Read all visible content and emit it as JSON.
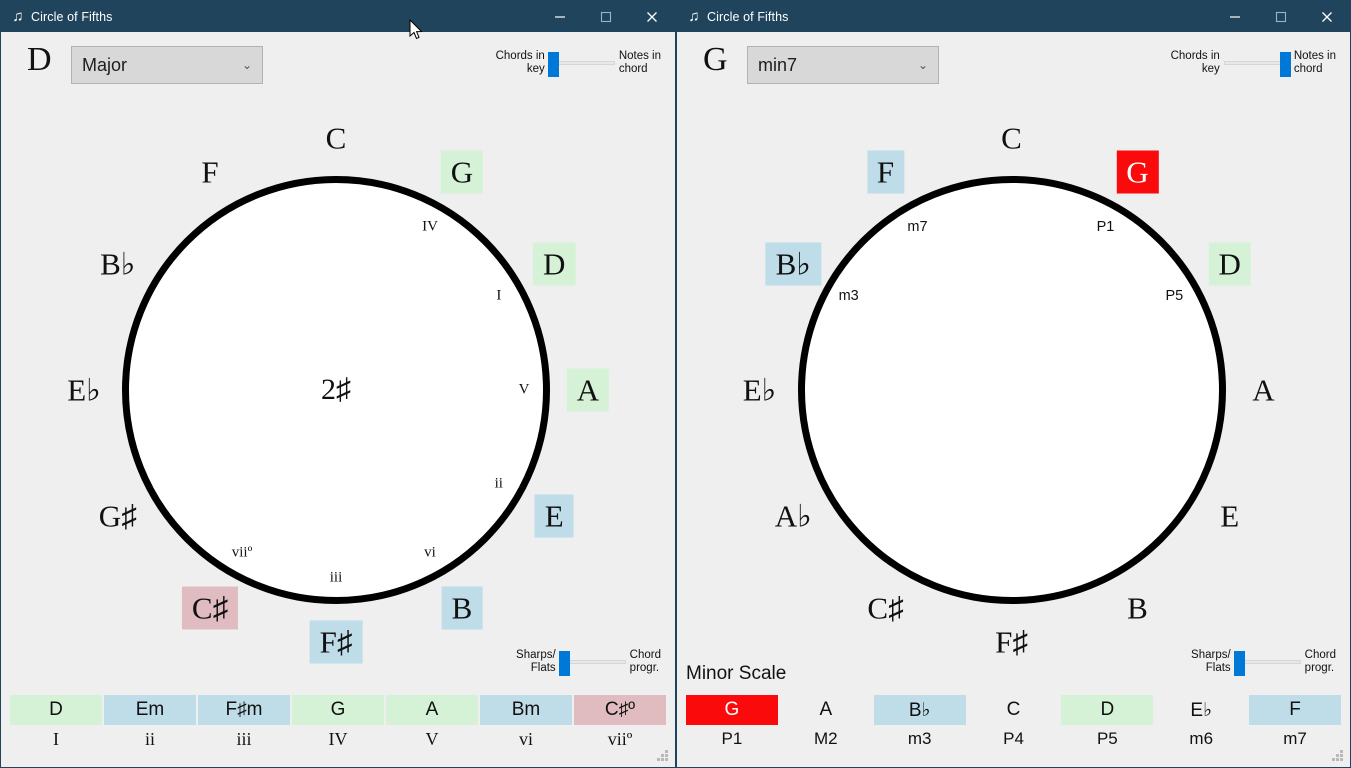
{
  "windows": [
    {
      "id": "left",
      "title": "Circle of Fifths",
      "icon": "music-note-icon",
      "controls": {
        "minimize": "minimize-icon",
        "maximize": "maximize-icon",
        "close": "close-icon"
      },
      "toolbar": {
        "key_letter": "D",
        "mode": "Major",
        "chevron": "⌄"
      },
      "top_slider": {
        "left_label": "Chords in\nkey",
        "right_label": "Notes in\nchord",
        "position": "left"
      },
      "circle": {
        "center_label": "2♯",
        "notes": [
          {
            "label": "C",
            "angle": 0,
            "highlight": "none"
          },
          {
            "label": "G",
            "angle": 30,
            "highlight": "green"
          },
          {
            "label": "D",
            "angle": 60,
            "highlight": "green"
          },
          {
            "label": "A",
            "angle": 90,
            "highlight": "green"
          },
          {
            "label": "E",
            "angle": 120,
            "highlight": "blue"
          },
          {
            "label": "B",
            "angle": 150,
            "highlight": "blue"
          },
          {
            "label": "F♯",
            "angle": 180,
            "highlight": "blue"
          },
          {
            "label": "C♯",
            "angle": 210,
            "highlight": "pink"
          },
          {
            "label": "G♯",
            "angle": 240,
            "highlight": "none"
          },
          {
            "label": "E♭",
            "angle": 270,
            "highlight": "none"
          },
          {
            "label": "B♭",
            "angle": 300,
            "highlight": "none"
          },
          {
            "label": "F",
            "angle": 330,
            "highlight": "none"
          }
        ],
        "degrees": [
          {
            "label": "IV",
            "angle": 30,
            "style": "serif"
          },
          {
            "label": "I",
            "angle": 60,
            "style": "serif"
          },
          {
            "label": "V",
            "angle": 90,
            "style": "serif"
          },
          {
            "label": "ii",
            "angle": 120,
            "style": "serif"
          },
          {
            "label": "vi",
            "angle": 150,
            "style": "serif"
          },
          {
            "label": "iii",
            "angle": 180,
            "style": "serif"
          },
          {
            "label": "viiº",
            "angle": 210,
            "style": "serif"
          }
        ]
      },
      "bottom_slider": {
        "left_label": "Sharps/\nFlats",
        "right_label": "Chord\nprogr.",
        "position": "left"
      },
      "scale_title": "",
      "table": {
        "chords": [
          "D",
          "Em",
          "F♯m",
          "G",
          "A",
          "Bm",
          "C♯º"
        ],
        "degrees": [
          "I",
          "ii",
          "iii",
          "IV",
          "V",
          "vi",
          "viiº"
        ],
        "degree_style": "serif",
        "highlights": [
          "green",
          "blue",
          "blue",
          "green",
          "green",
          "blue",
          "pink"
        ]
      }
    },
    {
      "id": "right",
      "title": "Circle of Fifths",
      "icon": "music-note-icon",
      "controls": {
        "minimize": "minimize-icon",
        "maximize": "maximize-icon",
        "close": "close-icon"
      },
      "toolbar": {
        "key_letter": "G",
        "mode": "min7",
        "chevron": "⌄"
      },
      "top_slider": {
        "left_label": "Chords in\nkey",
        "right_label": "Notes in\nchord",
        "position": "right"
      },
      "circle": {
        "center_label": "",
        "notes": [
          {
            "label": "C",
            "angle": 0,
            "highlight": "none"
          },
          {
            "label": "G",
            "angle": 30,
            "highlight": "red"
          },
          {
            "label": "D",
            "angle": 60,
            "highlight": "green"
          },
          {
            "label": "A",
            "angle": 90,
            "highlight": "none"
          },
          {
            "label": "E",
            "angle": 120,
            "highlight": "none"
          },
          {
            "label": "B",
            "angle": 150,
            "highlight": "none"
          },
          {
            "label": "F♯",
            "angle": 180,
            "highlight": "none"
          },
          {
            "label": "C♯",
            "angle": 210,
            "highlight": "none"
          },
          {
            "label": "A♭",
            "angle": 240,
            "highlight": "none"
          },
          {
            "label": "E♭",
            "angle": 270,
            "highlight": "none"
          },
          {
            "label": "B♭",
            "angle": 300,
            "highlight": "blue"
          },
          {
            "label": "F",
            "angle": 330,
            "highlight": "blue"
          }
        ],
        "degrees": [
          {
            "label": "P1",
            "angle": 30,
            "style": "sans"
          },
          {
            "label": "P5",
            "angle": 60,
            "style": "sans"
          },
          {
            "label": "m7",
            "angle": 330,
            "style": "sans"
          },
          {
            "label": "m3",
            "angle": 300,
            "style": "sans"
          }
        ]
      },
      "bottom_slider": {
        "left_label": "Sharps/\nFlats",
        "right_label": "Chord\nprogr.",
        "position": "left"
      },
      "scale_title": "Minor Scale",
      "table": {
        "chords": [
          "G",
          "A",
          "B♭",
          "C",
          "D",
          "E♭",
          "F"
        ],
        "degrees": [
          "P1",
          "M2",
          "m3",
          "P4",
          "P5",
          "m6",
          "m7"
        ],
        "degree_style": "sans",
        "highlights": [
          "red",
          "none",
          "blue",
          "none",
          "green",
          "none",
          "blue"
        ]
      }
    }
  ],
  "cursor": {
    "name": "mouse-pointer"
  },
  "colors": {
    "titlebar": "#20445c",
    "client_bg": "#efefef",
    "accent_blue": "#0078d7",
    "hl_green": "#d6f2d6",
    "hl_blue": "#bfdde9",
    "hl_pink": "#e0bcc0",
    "hl_red": "#fa0a0a",
    "circle_stroke": "#000000"
  }
}
